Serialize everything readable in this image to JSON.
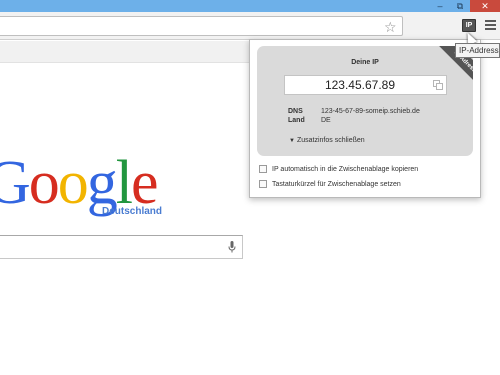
{
  "window": {
    "minimize_glyph": "–",
    "maximize_glyph": "⧉",
    "close_glyph": "✕"
  },
  "toolbar": {
    "extension_icon_text": "IP",
    "star_glyph": "☆",
    "tooltip": "IP-Address"
  },
  "google": {
    "logo_letters": [
      {
        "ch": "G",
        "color": "#3366e0"
      },
      {
        "ch": "o",
        "color": "#d62d20"
      },
      {
        "ch": "o",
        "color": "#f2b400"
      },
      {
        "ch": "g",
        "color": "#3366e0"
      },
      {
        "ch": "l",
        "color": "#22963f"
      },
      {
        "ch": "e",
        "color": "#d62d20"
      }
    ],
    "subtitle": "Deutschland"
  },
  "popup": {
    "ribbon": "IP-Adresse",
    "title": "Deine IP",
    "ip": "123.45.67.89",
    "dns_label": "DNS",
    "dns_value": "123-45-67-89-someip.schieb.de",
    "country_label": "Land",
    "country_value": "DE",
    "toggle_label": "Zusatzinfos schließen",
    "options": [
      {
        "label": "IP automatisch in die Zwischenablage kopieren",
        "checked": false
      },
      {
        "label": "Tastaturkürzel für Zwischenablage setzen",
        "checked": false
      }
    ]
  }
}
